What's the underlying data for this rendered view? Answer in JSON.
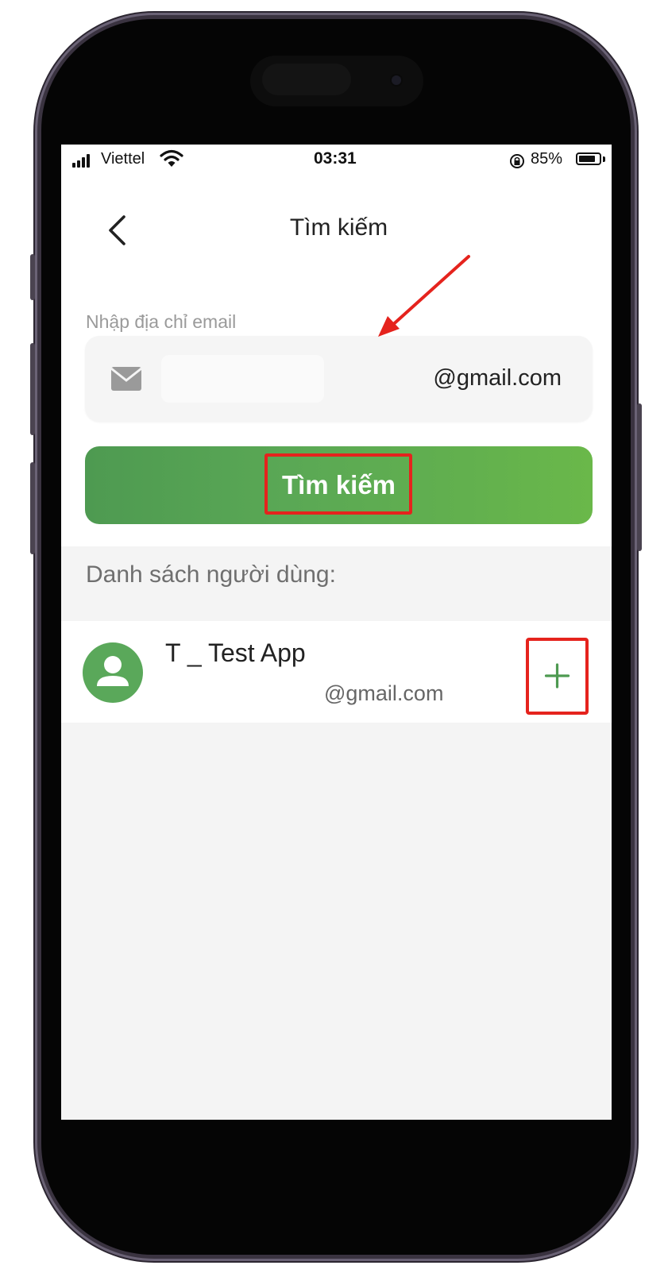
{
  "status_bar": {
    "carrier": "Viettel",
    "time": "03:31",
    "battery_percent": "85%",
    "battery_level": 0.85
  },
  "header": {
    "title": "Tìm kiếm",
    "back_icon": "chevron-left-icon"
  },
  "search_form": {
    "label": "Nhập địa chỉ email",
    "email_value": "@gmail.com",
    "input_icon": "mail-icon",
    "button_label": "Tìm kiếm"
  },
  "results": {
    "section_title": "Danh sách người dùng:",
    "users": [
      {
        "name": "T _ Test App",
        "email": "@gmail.com",
        "avatar_icon": "person-icon",
        "add_label": "+"
      }
    ]
  },
  "colors": {
    "accent_green": "#5aa855",
    "annotation_red": "#e5231d",
    "background": "#f4f4f4"
  }
}
